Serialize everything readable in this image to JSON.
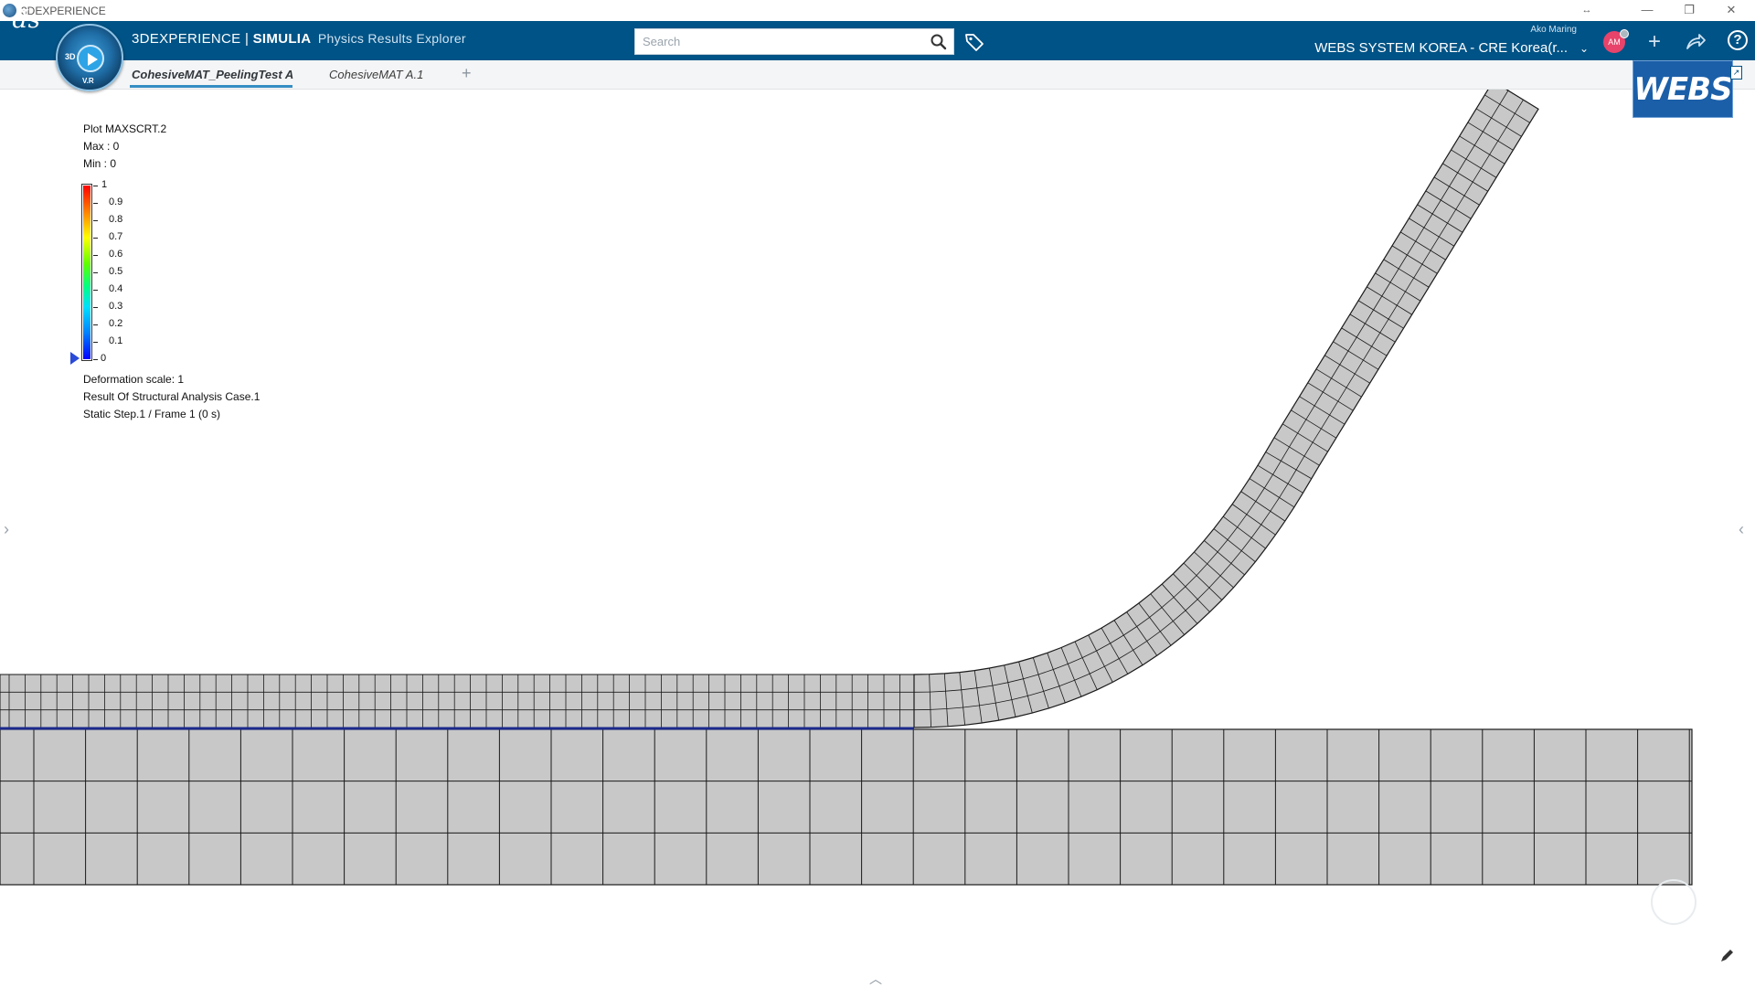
{
  "window": {
    "title": "3DEXPERIENCE",
    "minimize_glyph": "—",
    "restore_glyph": "❐",
    "close_glyph": "✕",
    "resize_glyph": "↔"
  },
  "topbar": {
    "brand_3dx": "3DEXPERIENCE",
    "brand_sep": " | ",
    "brand_simulia": "SIMULIA",
    "app_name": "Physics Results Explorer",
    "search_placeholder": "Search",
    "user_name": "Ako Maring",
    "tenant": "WEBS SYSTEM KOREA - CRE Korea(r...",
    "avatar_initials": "AM",
    "compass_labels": {
      "top": "3D",
      "bottom": "V.R"
    }
  },
  "tabs": [
    {
      "label": "CohesiveMAT_PeelingTest A",
      "active": true
    },
    {
      "label": "CohesiveMAT A.1",
      "active": false
    }
  ],
  "tab_add_label": "+",
  "overlay_logo": "WEBS",
  "legend": {
    "plot_name": "Plot MAXSCRT.2",
    "max": "Max : 0",
    "min": "Min : 0",
    "ticks": [
      "1",
      "0.9",
      "0.8",
      "0.7",
      "0.6",
      "0.5",
      "0.4",
      "0.3",
      "0.2",
      "0.1",
      "0"
    ],
    "deformation": "Deformation scale: 1",
    "result": "Result Of Structural Analysis Case.1",
    "step": "Static Step.1 / Frame 1 (0 s)"
  },
  "mesh": {
    "element_fill": "#c8c8c8",
    "edge_color": "#1a1a1a",
    "interface_color": "#1c2a8c"
  },
  "icons": {
    "ds_logo": "ds-logo-icon",
    "search": "search-icon",
    "tag": "tag-icon",
    "add": "plus-icon",
    "share": "share-icon",
    "help": "help-icon"
  }
}
